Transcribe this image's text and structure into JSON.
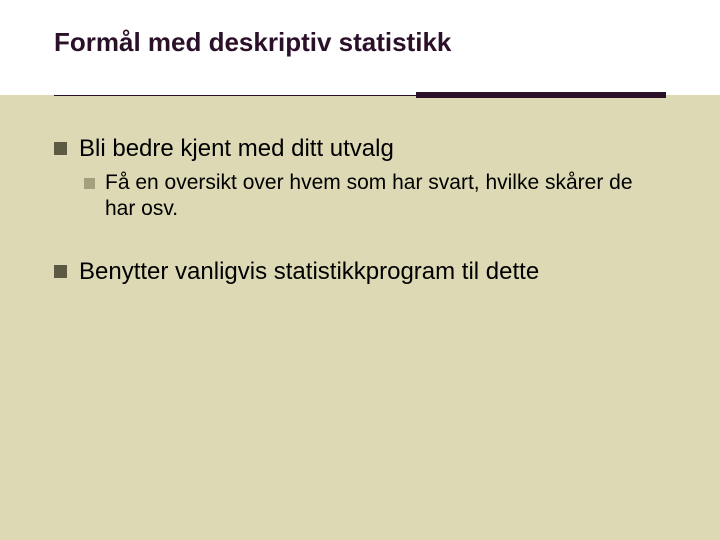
{
  "title": "Formål med deskriptiv statistikk",
  "bullets": {
    "b1": "Bli bedre kjent med ditt utvalg",
    "b1_1": "Få en oversikt over hvem som har svart, hvilke skårer de har osv.",
    "b2": "Benytter vanligvis statistikkprogram til dette"
  }
}
